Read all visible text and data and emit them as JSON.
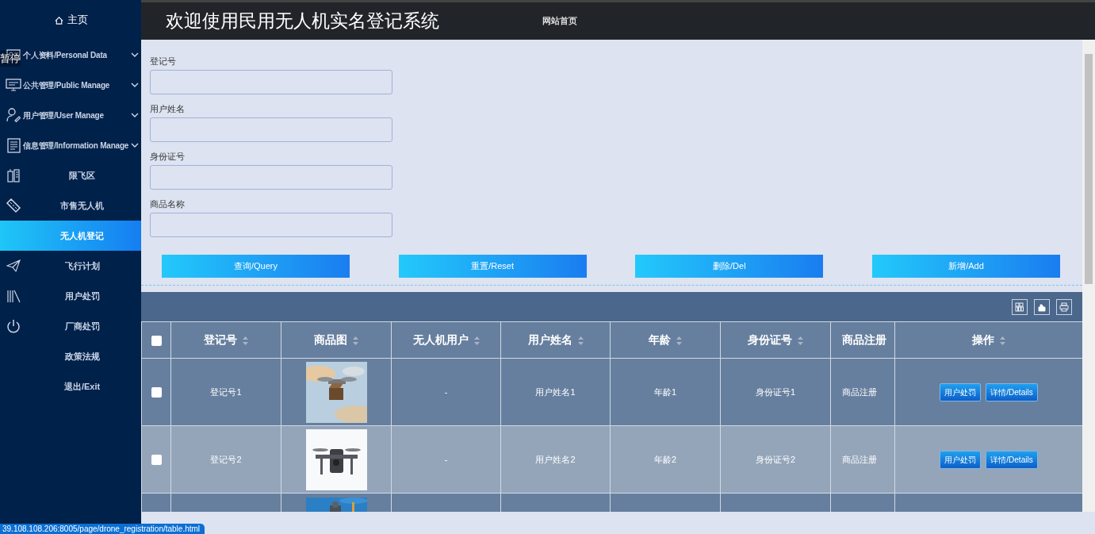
{
  "sidebar": {
    "home": {
      "label": "主页"
    },
    "items": [
      {
        "label": "个人资料/Personal Data",
        "expandable": true,
        "selected": false
      },
      {
        "label": "公共管理/Public Manage",
        "expandable": true,
        "selected": false
      },
      {
        "label": "用户管理/User Manage",
        "expandable": true,
        "selected": false
      },
      {
        "label": "信息管理/Information Manage",
        "expandable": true,
        "selected": false
      },
      {
        "label": "限飞区",
        "expandable": false,
        "selected": false
      },
      {
        "label": "市售无人机",
        "expandable": false,
        "selected": false
      },
      {
        "label": "无人机登记",
        "expandable": false,
        "selected": true
      },
      {
        "label": "飞行计划",
        "expandable": false,
        "selected": false
      },
      {
        "label": "用户处罚",
        "expandable": false,
        "selected": false
      },
      {
        "label": "厂商处罚",
        "expandable": false,
        "selected": false
      },
      {
        "label": "政策法规",
        "expandable": false,
        "selected": false
      },
      {
        "label": "退出/Exit",
        "expandable": false,
        "selected": false
      }
    ]
  },
  "player_overlay": {
    "label": "暂停"
  },
  "header": {
    "title": "欢迎使用民用无人机实名登记系统",
    "link": "网站首页"
  },
  "search_form": {
    "fields": [
      {
        "label": "登记号"
      },
      {
        "label": "用户姓名"
      },
      {
        "label": "身份证号"
      },
      {
        "label": "商品名称"
      }
    ],
    "buttons": [
      "查询/Query",
      "重置/Reset",
      "删除/Del",
      "新增/Add"
    ]
  },
  "table": {
    "all_checked": false,
    "columns": [
      {
        "label": "登记号",
        "sortable": true
      },
      {
        "label": "商品图",
        "sortable": true
      },
      {
        "label": "无人机用户",
        "sortable": true
      },
      {
        "label": "用户姓名",
        "sortable": true
      },
      {
        "label": "年龄",
        "sortable": true
      },
      {
        "label": "身份证号",
        "sortable": true
      },
      {
        "label": "商品注册",
        "sortable": false
      },
      {
        "label": "操作",
        "sortable": true
      }
    ],
    "rows": [
      {
        "kind": "full",
        "checked": false,
        "image": {
          "kind": "picture"
        },
        "cells": [
          "登记号1",
          "-",
          "用户姓名1",
          "年龄1",
          "身份证号1",
          "商品注册"
        ],
        "actions": [
          "用户处罚",
          "详情/Details"
        ]
      },
      {
        "kind": "full",
        "checked": false,
        "image": {
          "kind": "picture"
        },
        "cells": [
          "登记号2",
          "-",
          "用户姓名2",
          "年龄2",
          "身份证号2",
          "商品注册"
        ],
        "actions": [
          "用户处罚",
          "详情/Details"
        ]
      },
      {
        "kind": "cut_off",
        "image": {
          "kind": "picture"
        }
      }
    ]
  },
  "status_bar": {
    "url": "39.108.108.206:8005/page/drone_registration/table.html"
  }
}
